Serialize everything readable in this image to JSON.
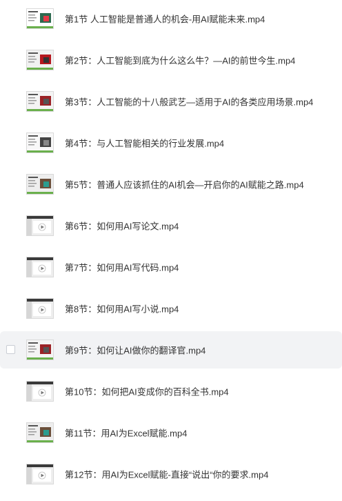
{
  "files": [
    {
      "name": "第1节 人工智能是普通人的机会-用AI赋能未来.mp4",
      "thumb": "slides-thumbnail-icon",
      "hovered": false
    },
    {
      "name": "第2节：人工智能到底为什么这么牛？—AI的前世今生.mp4",
      "thumb": "slides-thumbnail-icon",
      "hovered": false
    },
    {
      "name": "第3节：人工智能的十八般武艺—适用于AI的各类应用场景.mp4",
      "thumb": "slides-thumbnail-icon",
      "hovered": false
    },
    {
      "name": "第4节：与人工智能相关的行业发展.mp4",
      "thumb": "slides-thumbnail-icon",
      "hovered": false
    },
    {
      "name": "第5节：普通人应该抓住的AI机会—开启你的AI赋能之路.mp4",
      "thumb": "slides-thumbnail-icon",
      "hovered": false
    },
    {
      "name": "第6节：如何用AI写论文.mp4",
      "thumb": "screen-recording-thumbnail-icon",
      "hovered": false
    },
    {
      "name": "第7节：如何用AI写代码.mp4",
      "thumb": "screen-recording-thumbnail-icon",
      "hovered": false
    },
    {
      "name": "第8节：如何用AI写小说.mp4",
      "thumb": "screen-recording-thumbnail-icon",
      "hovered": false
    },
    {
      "name": "第9节：如何让AI做你的翻译官.mp4",
      "thumb": "slides-thumbnail-icon",
      "hovered": true
    },
    {
      "name": "第10节：如何把AI变成你的百科全书.mp4",
      "thumb": "screen-recording-thumbnail-icon",
      "hovered": false
    },
    {
      "name": "第11节：用AI为Excel赋能.mp4",
      "thumb": "slides-thumbnail-icon",
      "hovered": false
    },
    {
      "name": "第12节：用AI为Excel赋能-直接“说出“你的要求.mp4",
      "thumb": "screen-recording-thumbnail-icon",
      "hovered": false
    }
  ],
  "colors": {
    "text": "#333333",
    "hover_background": "#f2f3f5",
    "checkbox_border": "#c9cdd4"
  }
}
